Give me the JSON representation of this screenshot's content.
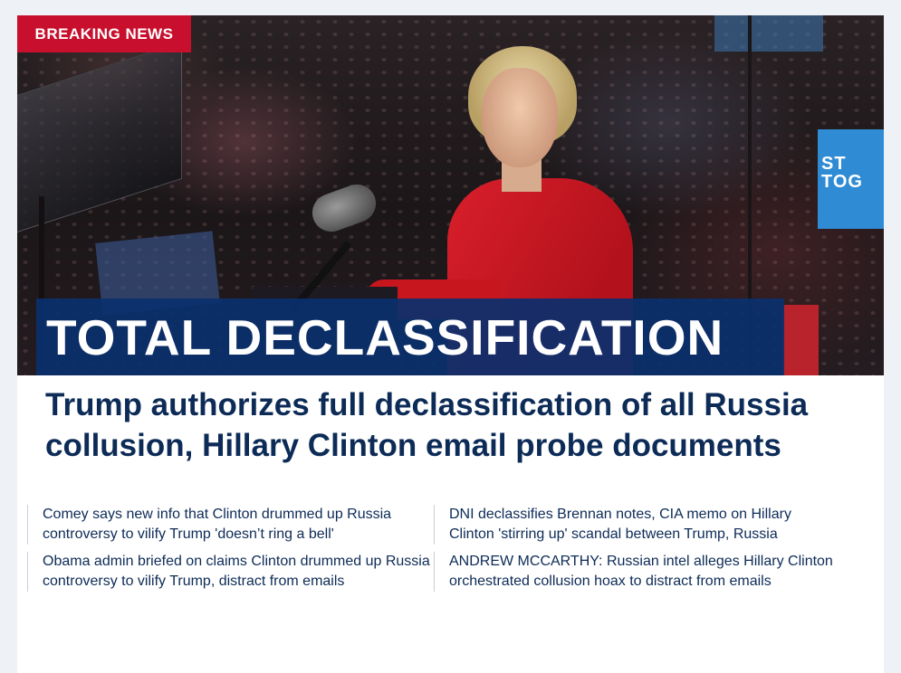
{
  "hero": {
    "badge": "BREAKING NEWS",
    "banner": "TOTAL DECLASSIFICATION",
    "image_alt": "Hillary Clinton speaking at a rally podium",
    "sign_text": "ST TOG"
  },
  "article": {
    "headline": "Trump authorizes full declassification of all Russia collusion, Hillary Clinton email probe documents"
  },
  "related": [
    {
      "text": "Comey says new info that Clinton drummed up Russia controversy to vilify Trump 'doesn’t ring a bell'"
    },
    {
      "text": "DNI declassifies Brennan notes, CIA memo on Hillary Clinton 'stirring up' scandal between Trump, Russia"
    },
    {
      "text": "Obama admin briefed on claims Clinton drummed up Russia controversy to vilify Trump, distract from emails"
    },
    {
      "text": "ANDREW MCCARTHY: Russian intel alleges Hillary Clinton orchestrated collusion hoax to distract from emails"
    }
  ],
  "colors": {
    "badge_red": "#c8102e",
    "banner_blue": "#0a306e",
    "headline_navy": "#0d2b57"
  }
}
